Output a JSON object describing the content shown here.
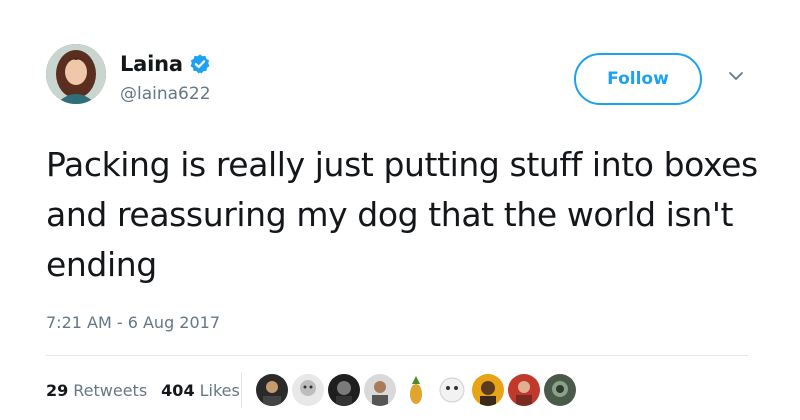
{
  "user": {
    "display_name": "Laina",
    "handle": "@laina622",
    "verified_icon": "verified-badge-icon"
  },
  "actions": {
    "follow_label": "Follow",
    "menu_icon": "chevron-down-icon"
  },
  "tweet": {
    "text": "Packing is really just putting stuff into boxes and reassuring my dog that the world isn't ending",
    "timestamp": "7:21 AM - 6 Aug 2017"
  },
  "stats": {
    "retweets_count": "29",
    "retweets_label": "Retweets",
    "likes_count": "404",
    "likes_label": "Likes"
  },
  "colors": {
    "accent": "#1da1f2",
    "text": "#14171a",
    "secondary": "#657786",
    "divider": "#e1e8ed"
  }
}
